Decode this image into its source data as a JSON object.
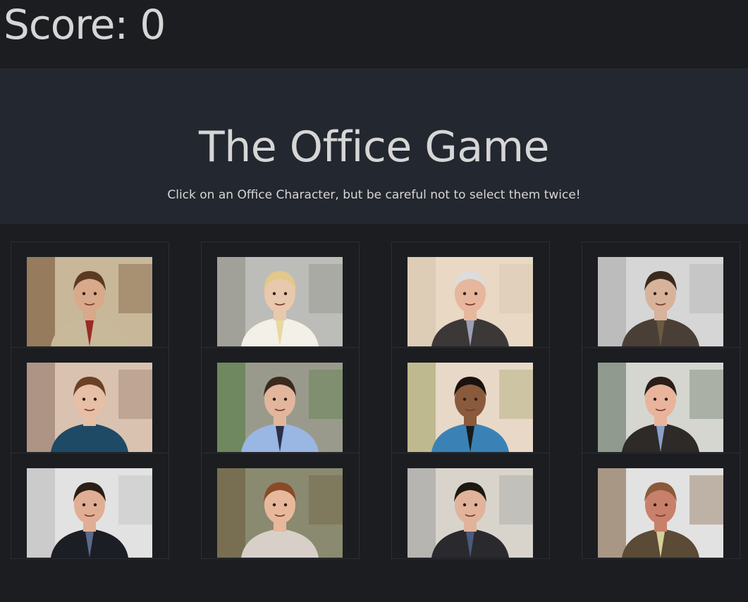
{
  "scoreboard": {
    "score_text": "Score: 0"
  },
  "header": {
    "title": "The Office Game",
    "instructions": "Click on an Office Character, but be careful not to select them twice!"
  },
  "characters": [
    {
      "bg": "#c9b79a",
      "accent": "#6b4a2a",
      "skin": "#d8a98a",
      "hair": "#5a3a22",
      "suit": "#c8b99a",
      "tie": "#9b2a25"
    },
    {
      "bg": "#bcbcb8",
      "accent": "#8a8a80",
      "skin": "#e8c9ad",
      "hair": "#e2c88a",
      "suit": "#f3f0e8",
      "tie": "#e8d9a0"
    },
    {
      "bg": "#e8d8c4",
      "accent": "#d4c2ac",
      "skin": "#e6b79d",
      "hair": "#dcdcdc",
      "suit": "#3c3838",
      "tie": "#9aa0b8"
    },
    {
      "bg": "#d6d6d6",
      "accent": "#a8a8a8",
      "skin": "#d8b29a",
      "hair": "#3a2a1e",
      "suit": "#4a3f36",
      "tie": "#6a5a40"
    },
    {
      "bg": "#d9c2b0",
      "accent": "#8b7060",
      "skin": "#e7bea6",
      "hair": "#6a4126",
      "suit": "#1e4a66",
      "tie": "#1e4a66"
    },
    {
      "bg": "#9a9a8c",
      "accent": "#4c7a3a",
      "skin": "#e1b69c",
      "hair": "#3a2a1e",
      "suit": "#9ab6e2",
      "tie": "#2a2f4a"
    },
    {
      "bg": "#e8d8c8",
      "accent": "#9aa060",
      "skin": "#8a5a3c",
      "hair": "#1a1210",
      "suit": "#3a82b6",
      "tie": "#1a1a1a"
    },
    {
      "bg": "#d6d6d0",
      "accent": "#5a6a5a",
      "skin": "#e8b49c",
      "hair": "#2a1e16",
      "suit": "#2e2a28",
      "tie": "#8aa0c8"
    },
    {
      "bg": "#e2e2e2",
      "accent": "#b8b8b8",
      "skin": "#e0ae94",
      "hair": "#2a1e16",
      "suit": "#1c1e26",
      "tie": "#5a6a8a"
    },
    {
      "bg": "#8a8a70",
      "accent": "#6a5a3a",
      "skin": "#e8b89c",
      "hair": "#8a4a26",
      "suit": "#d8d0c8",
      "tie": "#d8d0c8"
    },
    {
      "bg": "#d8d4cc",
      "accent": "#9a9a9a",
      "skin": "#e0b39a",
      "hair": "#1e1812",
      "suit": "#2a2a2e",
      "tie": "#4a5a7a"
    },
    {
      "bg": "#e2e2e2",
      "accent": "#7a5a3a",
      "skin": "#c8806a",
      "hair": "#8a5a3a",
      "suit": "#5a4a36",
      "tie": "#d4d09a"
    }
  ]
}
